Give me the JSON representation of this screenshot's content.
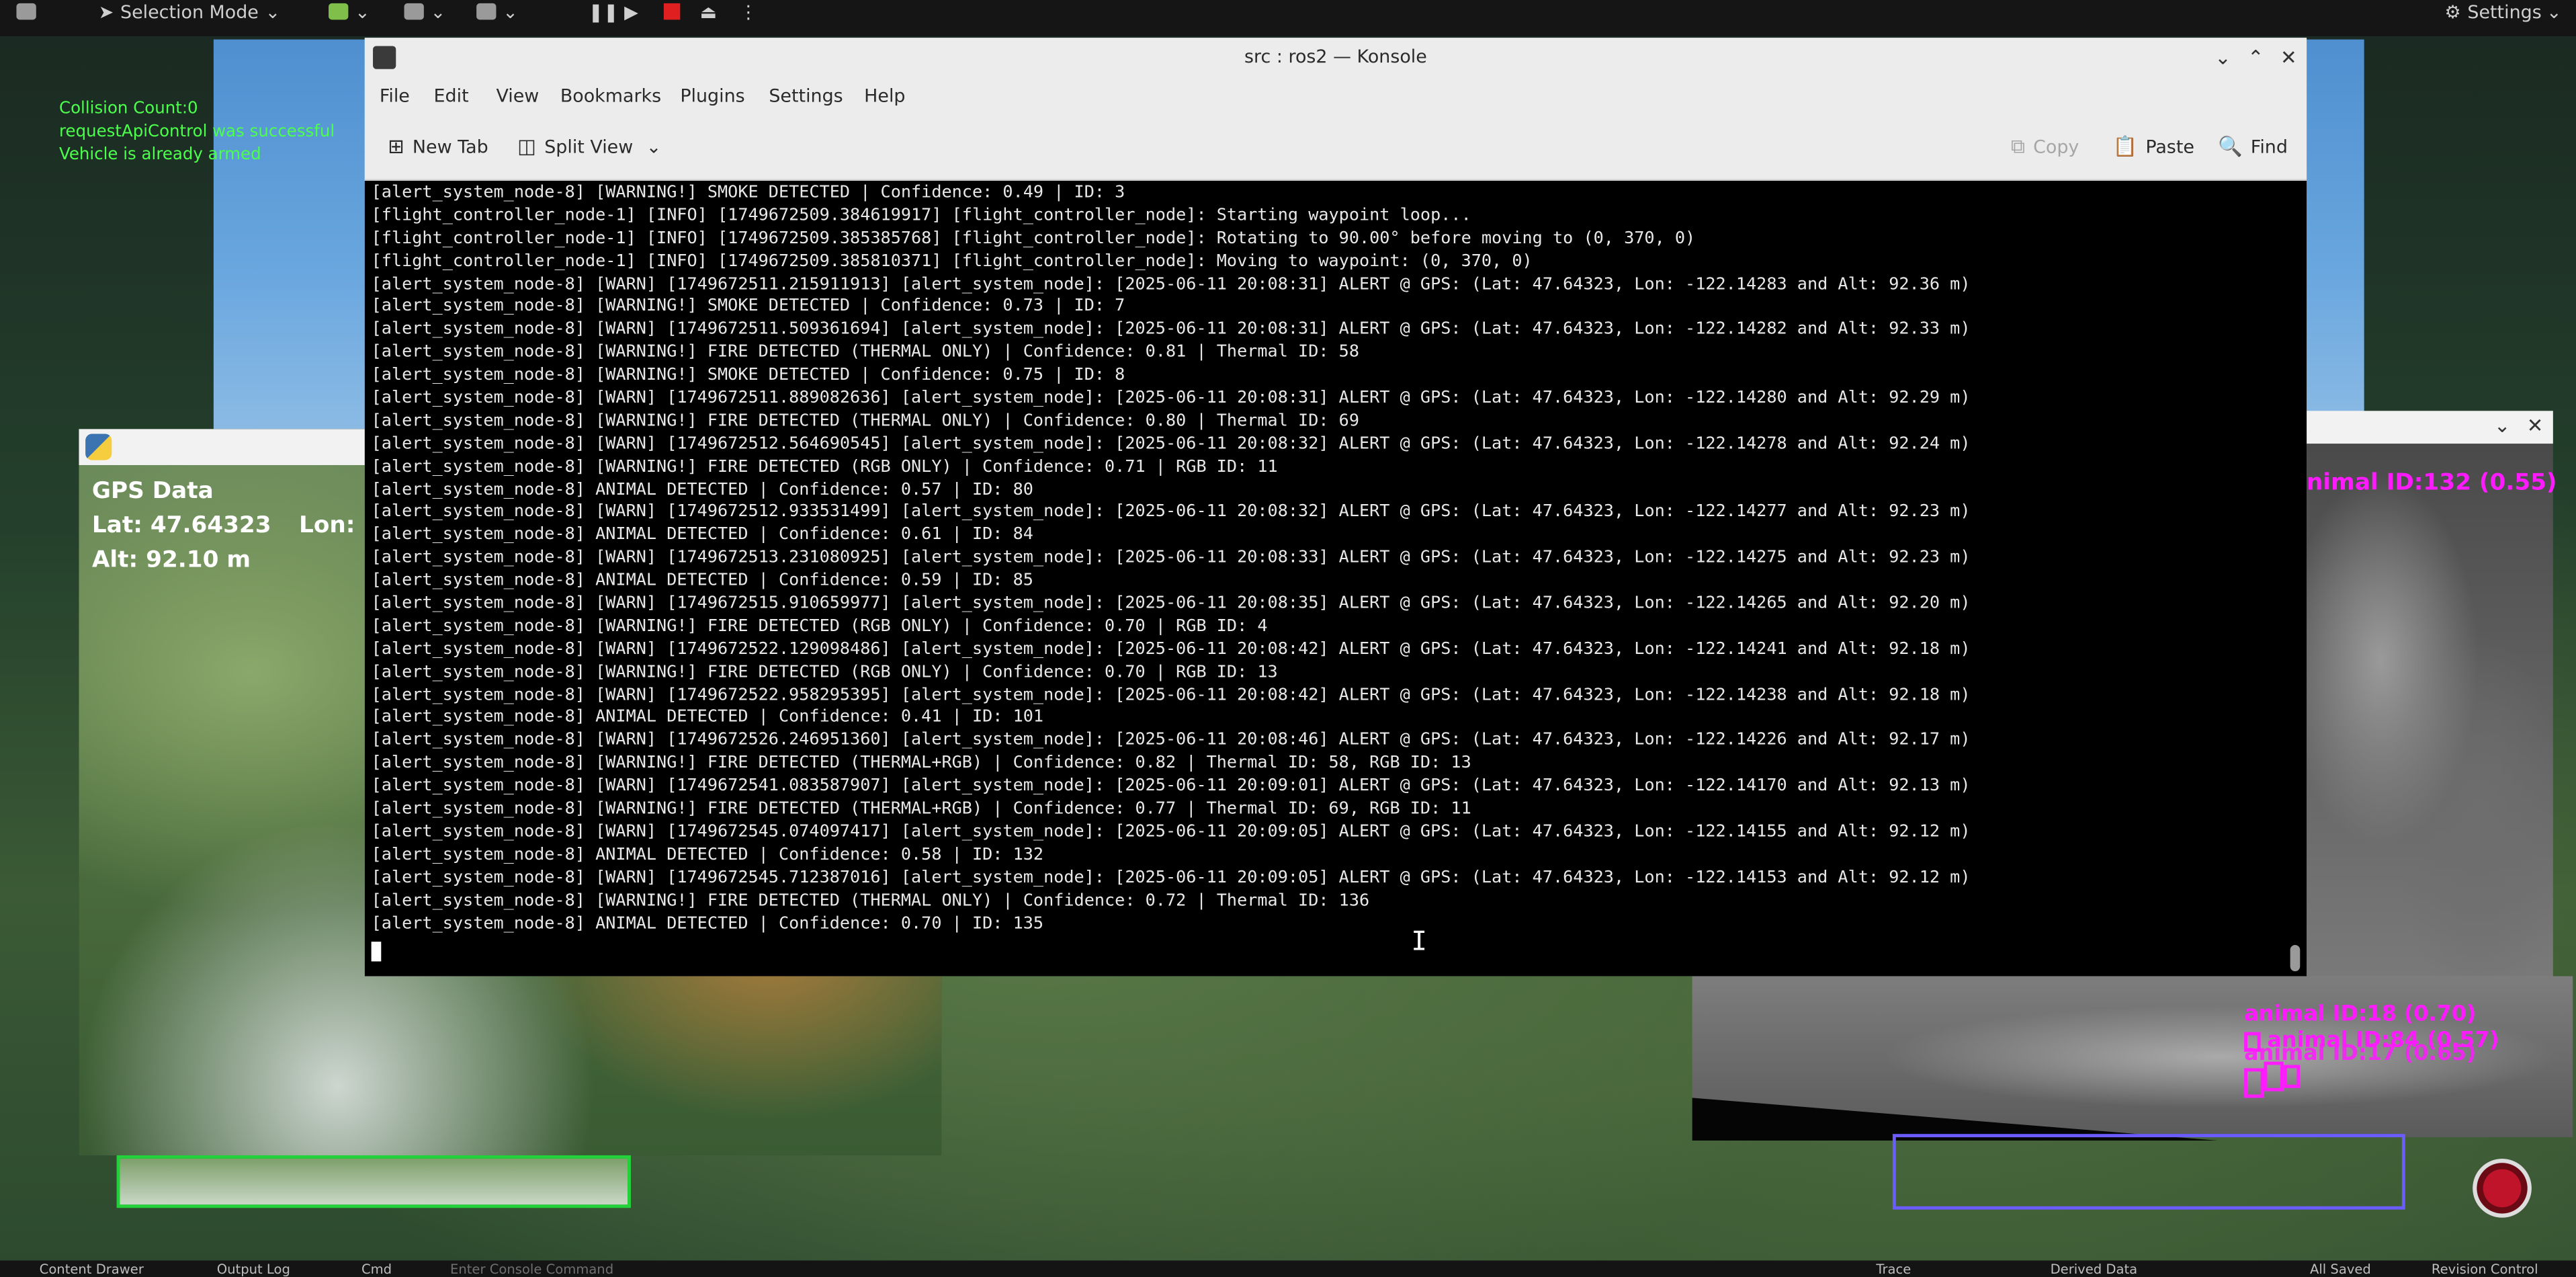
{
  "editor": {
    "selection_mode": "Selection Mode",
    "settings": "Settings",
    "bottom_bar": [
      "Content Drawer",
      "Output Log",
      "Cmd",
      "Enter Console Command",
      "Trace",
      "Derived Data",
      "All Saved",
      "Revision Control"
    ]
  },
  "osd": {
    "lines": [
      "Collision Count:0",
      "requestApiControl was successful",
      "Vehicle is already armed"
    ]
  },
  "gps": {
    "title": "GPS Data",
    "lat": "Lat: 47.64323",
    "lon": "Lon:",
    "alt": "Alt: 92.10 m"
  },
  "thermal": {
    "labels": [
      "nimal ID:132 (0.55)",
      "animal ID:18 (0.70)",
      "animal ID:84 (0.57)",
      "animal ID:17 (0.65)"
    ]
  },
  "konsole": {
    "title": "src : ros2 — Konsole",
    "menu": [
      "File",
      "Edit",
      "View",
      "Bookmarks",
      "Plugins",
      "Settings",
      "Help"
    ],
    "toolbar": {
      "new_tab": "New Tab",
      "split_view": "Split View",
      "copy": "Copy",
      "paste": "Paste",
      "find": "Find"
    },
    "lines": [
      "[alert_system_node-8] [WARNING!] SMOKE DETECTED | Confidence: 0.49 | ID: 3",
      "[flight_controller_node-1] [INFO] [1749672509.384619917] [flight_controller_node]: Starting waypoint loop...",
      "[flight_controller_node-1] [INFO] [1749672509.385385768] [flight_controller_node]: Rotating to 90.00° before moving to (0, 370, 0)",
      "[flight_controller_node-1] [INFO] [1749672509.385810371] [flight_controller_node]: Moving to waypoint: (0, 370, 0)",
      "[alert_system_node-8] [WARN] [1749672511.215911913] [alert_system_node]: [2025-06-11 20:08:31] ALERT @ GPS: (Lat: 47.64323, Lon: -122.14283 and Alt: 92.36 m)",
      "[alert_system_node-8] [WARNING!] SMOKE DETECTED | Confidence: 0.73 | ID: 7",
      "[alert_system_node-8] [WARN] [1749672511.509361694] [alert_system_node]: [2025-06-11 20:08:31] ALERT @ GPS: (Lat: 47.64323, Lon: -122.14282 and Alt: 92.33 m)",
      "[alert_system_node-8] [WARNING!] FIRE DETECTED (THERMAL ONLY) | Confidence: 0.81 | Thermal ID: 58",
      "[alert_system_node-8] [WARNING!] SMOKE DETECTED | Confidence: 0.75 | ID: 8",
      "[alert_system_node-8] [WARN] [1749672511.889082636] [alert_system_node]: [2025-06-11 20:08:31] ALERT @ GPS: (Lat: 47.64323, Lon: -122.14280 and Alt: 92.29 m)",
      "[alert_system_node-8] [WARNING!] FIRE DETECTED (THERMAL ONLY) | Confidence: 0.80 | Thermal ID: 69",
      "[alert_system_node-8] [WARN] [1749672512.564690545] [alert_system_node]: [2025-06-11 20:08:32] ALERT @ GPS: (Lat: 47.64323, Lon: -122.14278 and Alt: 92.24 m)",
      "[alert_system_node-8] [WARNING!] FIRE DETECTED (RGB ONLY) | Confidence: 0.71 | RGB ID: 11",
      "[alert_system_node-8] ANIMAL DETECTED | Confidence: 0.57 | ID: 80",
      "[alert_system_node-8] [WARN] [1749672512.933531499] [alert_system_node]: [2025-06-11 20:08:32] ALERT @ GPS: (Lat: 47.64323, Lon: -122.14277 and Alt: 92.23 m)",
      "[alert_system_node-8] ANIMAL DETECTED | Confidence: 0.61 | ID: 84",
      "[alert_system_node-8] [WARN] [1749672513.231080925] [alert_system_node]: [2025-06-11 20:08:33] ALERT @ GPS: (Lat: 47.64323, Lon: -122.14275 and Alt: 92.23 m)",
      "[alert_system_node-8] ANIMAL DETECTED | Confidence: 0.59 | ID: 85",
      "[alert_system_node-8] [WARN] [1749672515.910659977] [alert_system_node]: [2025-06-11 20:08:35] ALERT @ GPS: (Lat: 47.64323, Lon: -122.14265 and Alt: 92.20 m)",
      "[alert_system_node-8] [WARNING!] FIRE DETECTED (RGB ONLY) | Confidence: 0.70 | RGB ID: 4",
      "[alert_system_node-8] [WARN] [1749672522.129098486] [alert_system_node]: [2025-06-11 20:08:42] ALERT @ GPS: (Lat: 47.64323, Lon: -122.14241 and Alt: 92.18 m)",
      "[alert_system_node-8] [WARNING!] FIRE DETECTED (RGB ONLY) | Confidence: 0.70 | RGB ID: 13",
      "[alert_system_node-8] [WARN] [1749672522.958295395] [alert_system_node]: [2025-06-11 20:08:42] ALERT @ GPS: (Lat: 47.64323, Lon: -122.14238 and Alt: 92.18 m)",
      "[alert_system_node-8] ANIMAL DETECTED | Confidence: 0.41 | ID: 101",
      "[alert_system_node-8] [WARN] [1749672526.246951360] [alert_system_node]: [2025-06-11 20:08:46] ALERT @ GPS: (Lat: 47.64323, Lon: -122.14226 and Alt: 92.17 m)",
      "[alert_system_node-8] [WARNING!] FIRE DETECTED (THERMAL+RGB) | Confidence: 0.82 | Thermal ID: 58, RGB ID: 13",
      "[alert_system_node-8] [WARN] [1749672541.083587907] [alert_system_node]: [2025-06-11 20:09:01] ALERT @ GPS: (Lat: 47.64323, Lon: -122.14170 and Alt: 92.13 m)",
      "[alert_system_node-8] [WARNING!] FIRE DETECTED (THERMAL+RGB) | Confidence: 0.77 | Thermal ID: 69, RGB ID: 11",
      "[alert_system_node-8] [WARN] [1749672545.074097417] [alert_system_node]: [2025-06-11 20:09:05] ALERT @ GPS: (Lat: 47.64323, Lon: -122.14155 and Alt: 92.12 m)",
      "[alert_system_node-8] ANIMAL DETECTED | Confidence: 0.58 | ID: 132",
      "[alert_system_node-8] [WARN] [1749672545.712387016] [alert_system_node]: [2025-06-11 20:09:05] ALERT @ GPS: (Lat: 47.64323, Lon: -122.14153 and Alt: 92.12 m)",
      "[alert_system_node-8] [WARNING!] FIRE DETECTED (THERMAL ONLY) | Confidence: 0.72 | Thermal ID: 136",
      "[alert_system_node-8] ANIMAL DETECTED | Confidence: 0.70 | ID: 135"
    ]
  }
}
